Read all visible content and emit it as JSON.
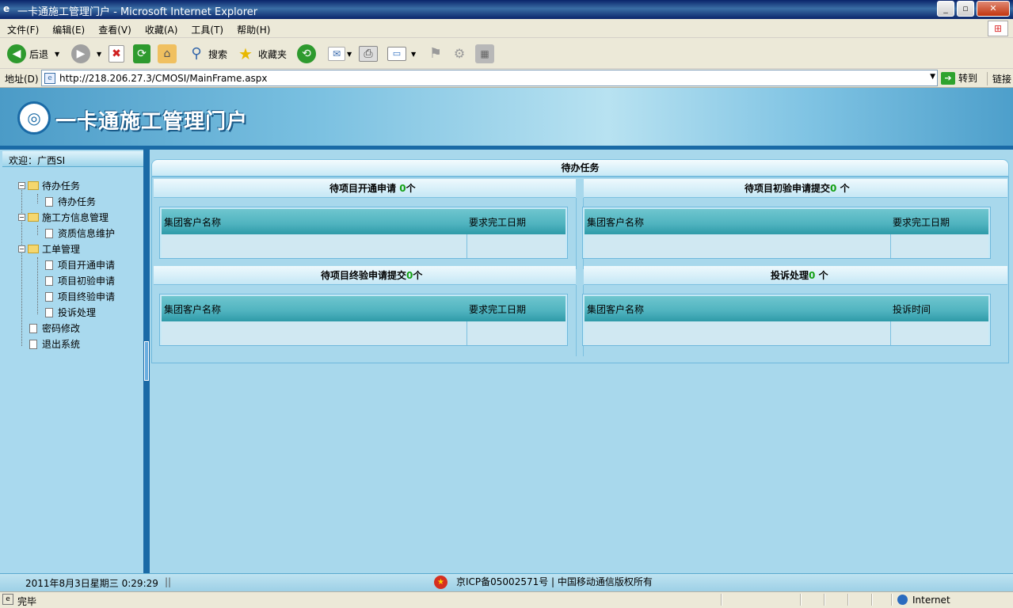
{
  "window": {
    "title": "一卡通施工管理门户 - Microsoft Internet Explorer"
  },
  "menubar": {
    "items": [
      "文件(F)",
      "编辑(E)",
      "查看(V)",
      "收藏(A)",
      "工具(T)",
      "帮助(H)"
    ]
  },
  "toolbar": {
    "back_label": "后退",
    "search_label": "搜索",
    "favorites_label": "收藏夹"
  },
  "addressbar": {
    "label": "地址(D)",
    "url": "http://218.206.27.3/CMOSI/MainFrame.aspx",
    "go_label": "转到",
    "links_label": "链接"
  },
  "page": {
    "portal_title": "一卡通施工管理门户",
    "welcome": "欢迎：广西SI",
    "nav": [
      {
        "label": "待办任务",
        "type": "folder"
      },
      {
        "label": "待办任务",
        "type": "doc"
      },
      {
        "label": "施工方信息管理",
        "type": "folder"
      },
      {
        "label": "资质信息维护",
        "type": "doc"
      },
      {
        "label": "工单管理",
        "type": "folder"
      },
      {
        "label": "项目开通申请",
        "type": "doc"
      },
      {
        "label": "项目初验申请",
        "type": "doc"
      },
      {
        "label": "项目终验申请",
        "type": "doc"
      },
      {
        "label": "投诉处理",
        "type": "doc"
      },
      {
        "label": "密码修改",
        "type": "doc"
      },
      {
        "label": "退出系统",
        "type": "doc"
      }
    ],
    "tasks": {
      "title": "待办任务",
      "sections": [
        {
          "prefix": "待项目开通申请",
          "count": "0",
          "suffix": "个",
          "col1": "集团客户名称",
          "col2": "要求完工日期"
        },
        {
          "prefix": "待项目初验申请提交",
          "count": "0",
          "suffix": "个",
          "col1": "集团客户名称",
          "col2": "要求完工日期"
        },
        {
          "prefix": "待项目终验申请提交",
          "count": "0",
          "suffix": "个",
          "col1": "集团客户名称",
          "col2": "要求完工日期"
        },
        {
          "prefix": "投诉处理",
          "count": "0",
          "suffix": "个",
          "col1": "集团客户名称",
          "col2": "投诉时间"
        }
      ]
    },
    "footer": {
      "datetime": "2011年8月3日星期三  0:29:29",
      "separator": "||",
      "icp": "京ICP备05002571号 | 中国移动通信版权所有"
    }
  },
  "statusbar": {
    "status": "完毕",
    "zone": "Internet"
  }
}
